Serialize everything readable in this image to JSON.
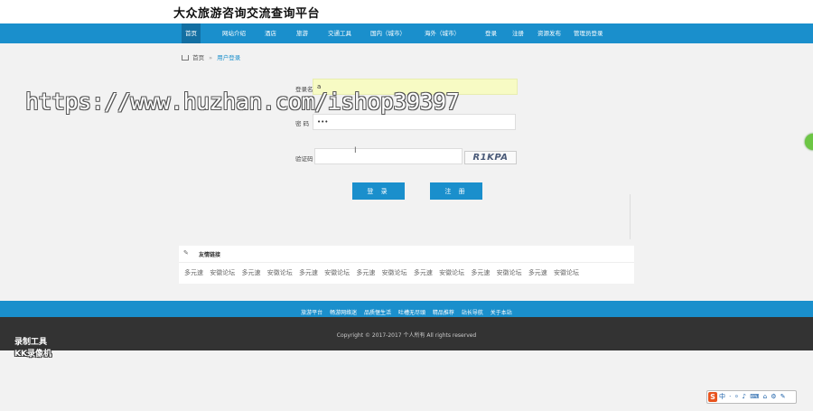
{
  "site": {
    "title": "大众旅游咨询交流查询平台"
  },
  "nav": {
    "items": [
      {
        "label": "首页",
        "active": true
      },
      {
        "label": "网站介绍"
      },
      {
        "label": "酒店"
      },
      {
        "label": "旅游"
      },
      {
        "label": "交通工具"
      },
      {
        "label": "国内（城市）"
      },
      {
        "label": "海外（城市）"
      },
      {
        "label": "登录"
      },
      {
        "label": "注册"
      },
      {
        "label": "资源发布"
      },
      {
        "label": "管理员登录"
      }
    ]
  },
  "breadcrumb": {
    "home": "首页",
    "separator": "»",
    "current": "用户登录"
  },
  "login_form": {
    "username": {
      "label": "登录名",
      "value": "a"
    },
    "password": {
      "label": "密 码",
      "value": "•••"
    },
    "captcha": {
      "label": "验证码",
      "value": "",
      "image_text": "R1KPA"
    },
    "login_button": "登 录",
    "register_button": "注 册"
  },
  "watermark": "https://www.huzhan.com/ishop39397",
  "friend_links": {
    "title": "友情链接",
    "items": [
      "多元速",
      "安徽论坛",
      "多元速",
      "安徽论坛",
      "多元速",
      "安徽论坛",
      "多元速",
      "安徽论坛",
      "多元速",
      "安徽论坛",
      "多元速",
      "安徽论坛",
      "多元速",
      "安徽论坛"
    ]
  },
  "footer": {
    "links": [
      "旅游平台",
      "畅游网络迷",
      "品质惬生活",
      "吐槽无尽頭",
      "精品推荐",
      "站长导航",
      "关于本站"
    ],
    "copyright": "Copyright © 2017-2017 个人所有 All rights reserved"
  },
  "overlay": {
    "recorder_line1": "录制工具",
    "recorder_line2": "KK录像机",
    "ime_text": "中 ⸱ ⸰ ♪ ⌨ ⌂ ⚙ ✎"
  },
  "colors": {
    "primary": "#1a8fcc",
    "nav_active": "#136fa2",
    "footer_dark": "#333333",
    "username_bg": "#f7fbc4"
  }
}
